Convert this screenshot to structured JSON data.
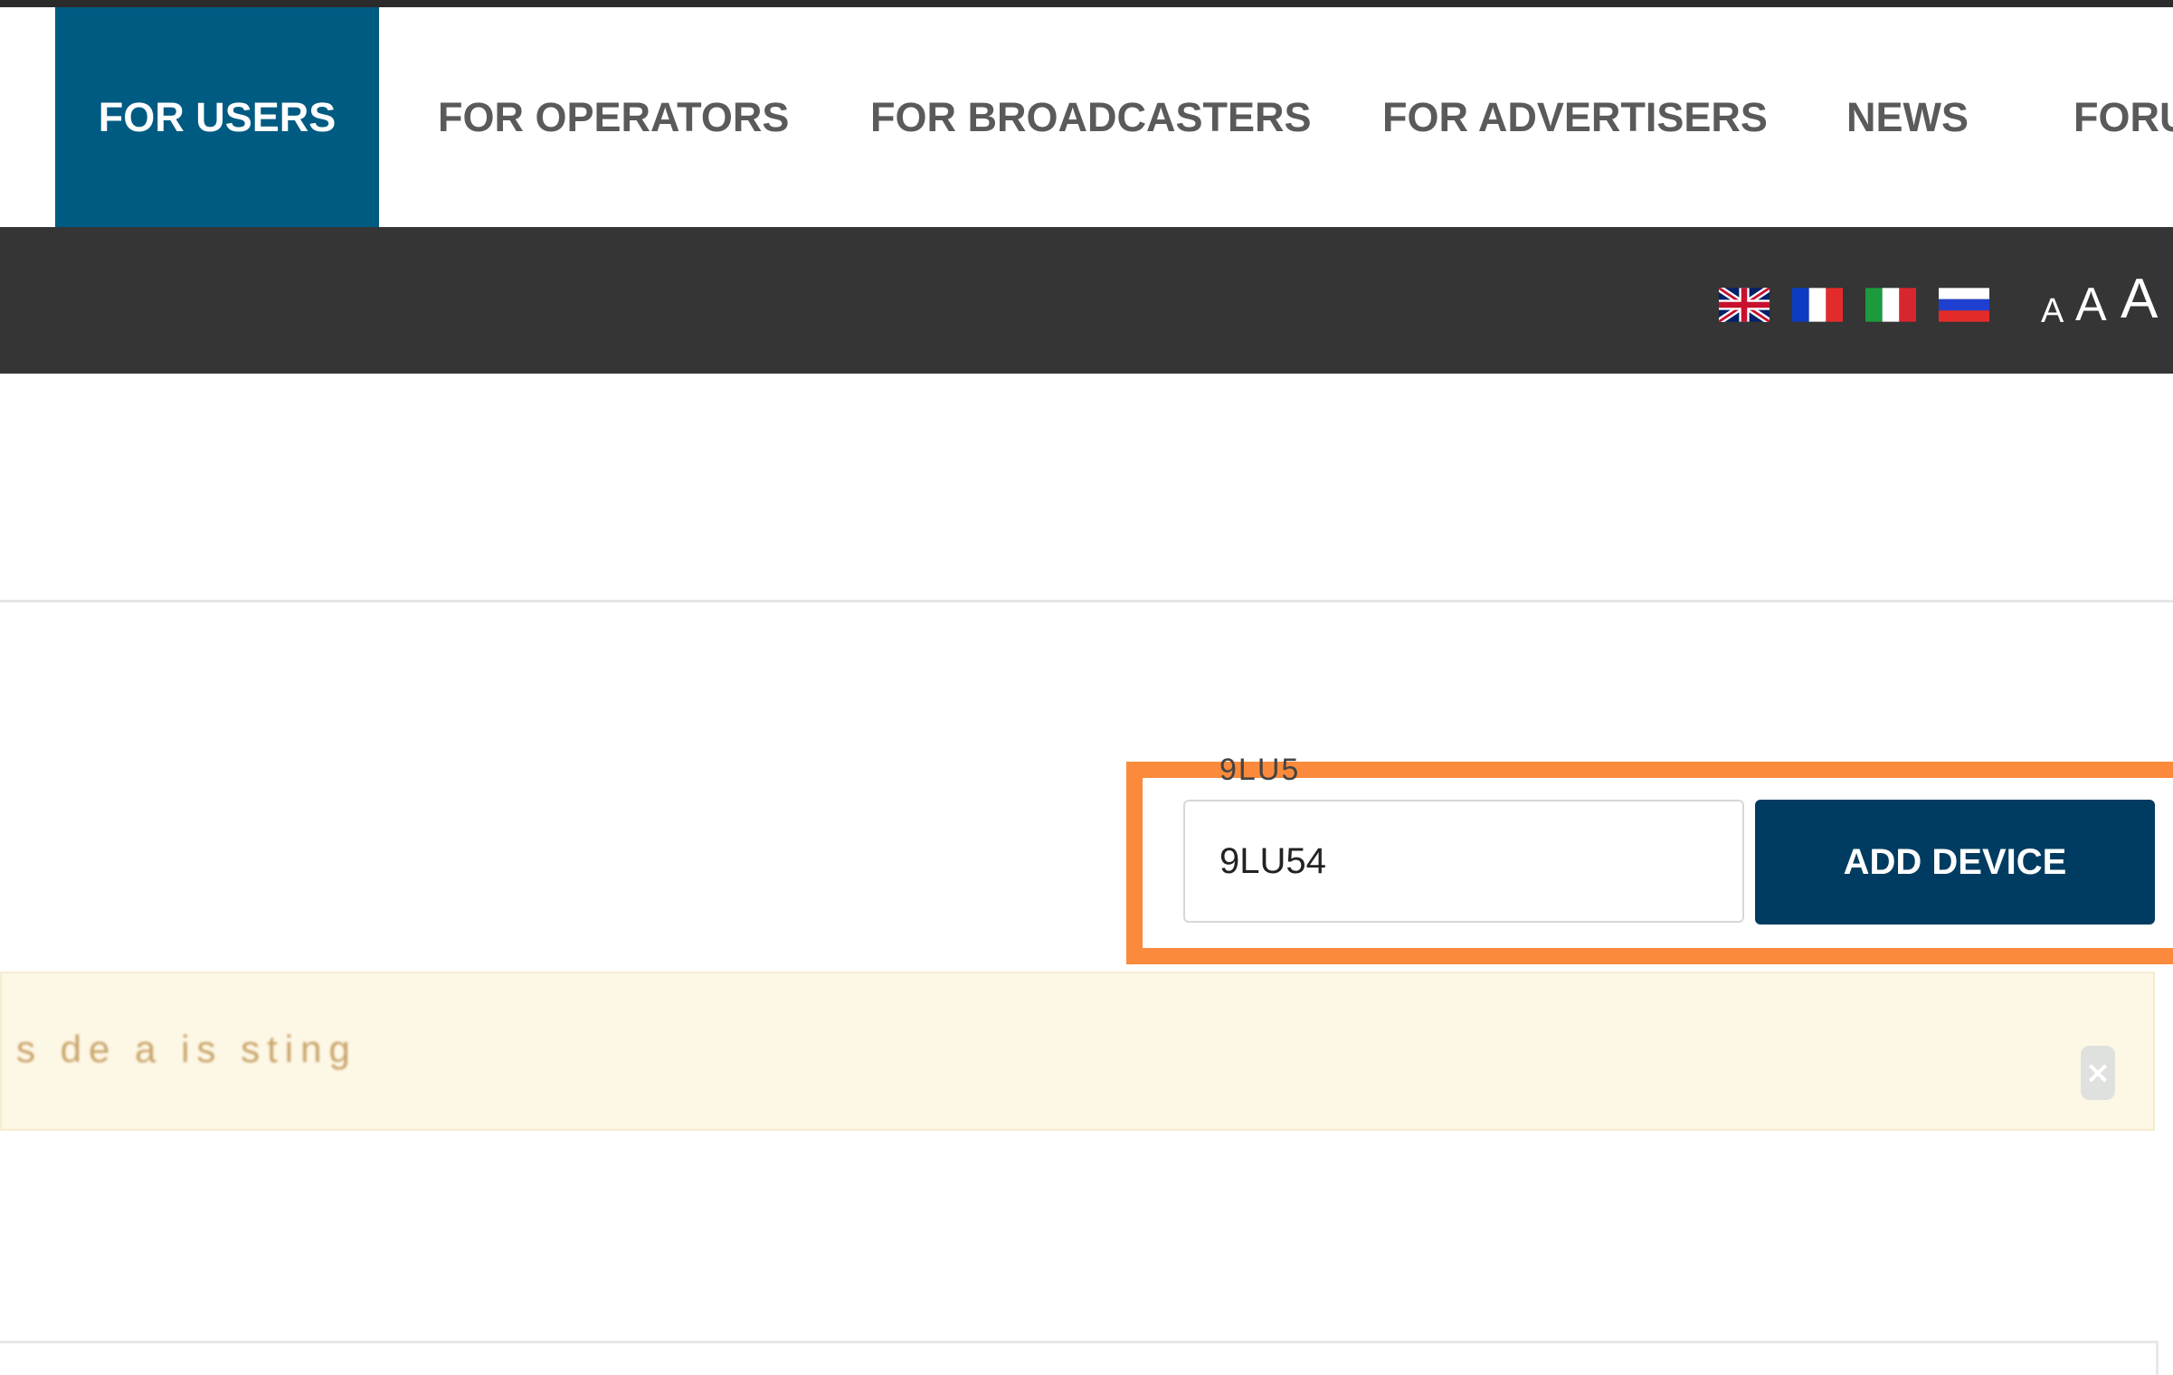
{
  "nav": {
    "items": [
      {
        "label": "FOR USERS",
        "active": true
      },
      {
        "label": "FOR OPERATORS",
        "active": false
      },
      {
        "label": "FOR BROADCASTERS",
        "active": false
      },
      {
        "label": "FOR ADVERTISERS",
        "active": false
      },
      {
        "label": "NEWS",
        "active": false
      },
      {
        "label": "FORU",
        "active": false
      }
    ],
    "active_color": "#005b82"
  },
  "utility_bar": {
    "languages": [
      {
        "icon": "uk-flag-icon"
      },
      {
        "icon": "france-flag-icon"
      },
      {
        "icon": "italy-flag-icon"
      },
      {
        "icon": "russia-flag-icon"
      }
    ],
    "font_sizes": [
      {
        "label": "A"
      },
      {
        "label": "A"
      },
      {
        "label": "A"
      }
    ]
  },
  "device_form": {
    "hint": "9LU5",
    "input_value": "9LU54",
    "button_label": "ADD DEVICE",
    "highlight_color": "#fb8a3c",
    "button_color": "#003c61"
  },
  "alert": {
    "text": "s de a is sting",
    "close_icon": "close-icon"
  }
}
